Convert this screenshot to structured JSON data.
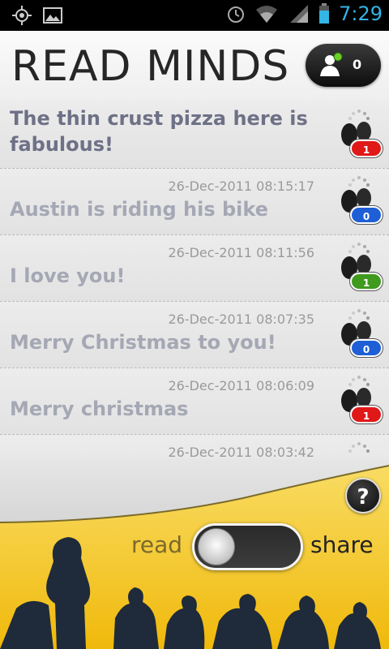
{
  "status_bar": {
    "time": "7:29",
    "left_icons": [
      "gps-icon",
      "image-icon"
    ],
    "right_icons": [
      "alarm-icon",
      "wifi-icon",
      "signal-icon",
      "battery-icon"
    ]
  },
  "header": {
    "title": "READ MINDS",
    "users_count": "0"
  },
  "feed": [
    {
      "timestamp": "",
      "message": "The thin crust pizza here is fabulous!",
      "count": "1",
      "color": "#e01818"
    },
    {
      "timestamp": "26-Dec-2011 08:15:17",
      "message": "Austin is riding his bike",
      "count": "0",
      "color": "#1e5fd6"
    },
    {
      "timestamp": "26-Dec-2011 08:11:56",
      "message": "I love you!",
      "count": "1",
      "color": "#3f9a1e"
    },
    {
      "timestamp": "26-Dec-2011 08:07:35",
      "message": "Merry Christmas to you!",
      "count": "0",
      "color": "#1e5fd6"
    },
    {
      "timestamp": "26-Dec-2011 08:06:09",
      "message": "Merry christmas",
      "count": "1",
      "color": "#e01818"
    },
    {
      "timestamp": "26-Dec-2011 08:03:42",
      "message": "",
      "count": "",
      "color": "#1e5fd6"
    }
  ],
  "bottom": {
    "help_label": "?",
    "read_label": "read",
    "share_label": "share",
    "mode": "read"
  },
  "colors": {
    "accent_yellow": "#f4c21c",
    "time_blue": "#33b5e5"
  }
}
